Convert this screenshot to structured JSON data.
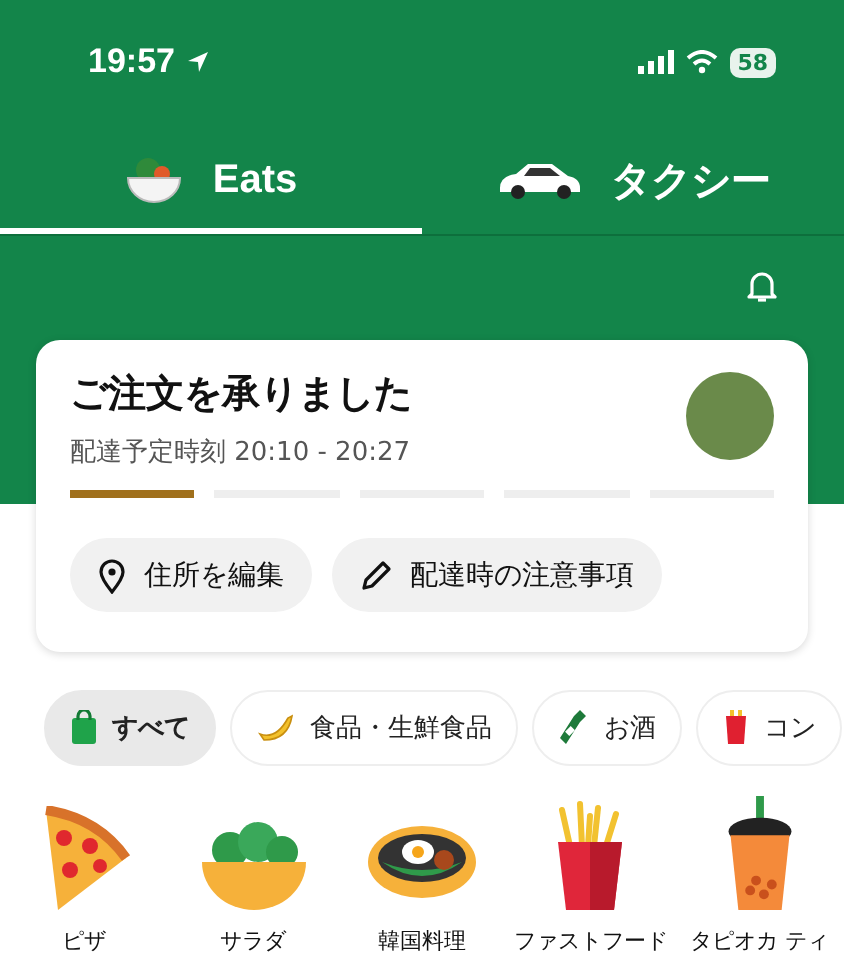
{
  "status_bar": {
    "time": "19:57",
    "battery": "58"
  },
  "tabs": [
    {
      "label": "Eats",
      "kind": "eats",
      "selected": true
    },
    {
      "label": "タクシー",
      "kind": "taxi",
      "selected": false
    }
  ],
  "order_card": {
    "title": "ご注文を承りました",
    "subtitle": "配達予定時刻 20:10 - 20:27",
    "progress": [
      {
        "done": true
      },
      {
        "done": false
      },
      {
        "done": false
      },
      {
        "done": false
      },
      {
        "done": false
      }
    ],
    "actions": [
      {
        "label": "住所を編集",
        "kind": "pin"
      },
      {
        "label": "配達時の注意事項",
        "kind": "pencil"
      }
    ]
  },
  "category_chips": [
    {
      "label": "すべて",
      "kind": "bag",
      "selected": true
    },
    {
      "label": "食品・生鮮食品",
      "kind": "banana",
      "selected": false
    },
    {
      "label": "お酒",
      "kind": "bottle",
      "selected": false
    },
    {
      "label": "コン",
      "kind": "snack",
      "selected": false
    }
  ],
  "food_categories": [
    {
      "label": "ピザ",
      "kind": "pizza"
    },
    {
      "label": "サラダ",
      "kind": "salad"
    },
    {
      "label": "韓国料理",
      "kind": "bibimbap"
    },
    {
      "label": "ファストフード",
      "kind": "fries"
    },
    {
      "label": "タピオカ ティ",
      "kind": "boba"
    }
  ]
}
